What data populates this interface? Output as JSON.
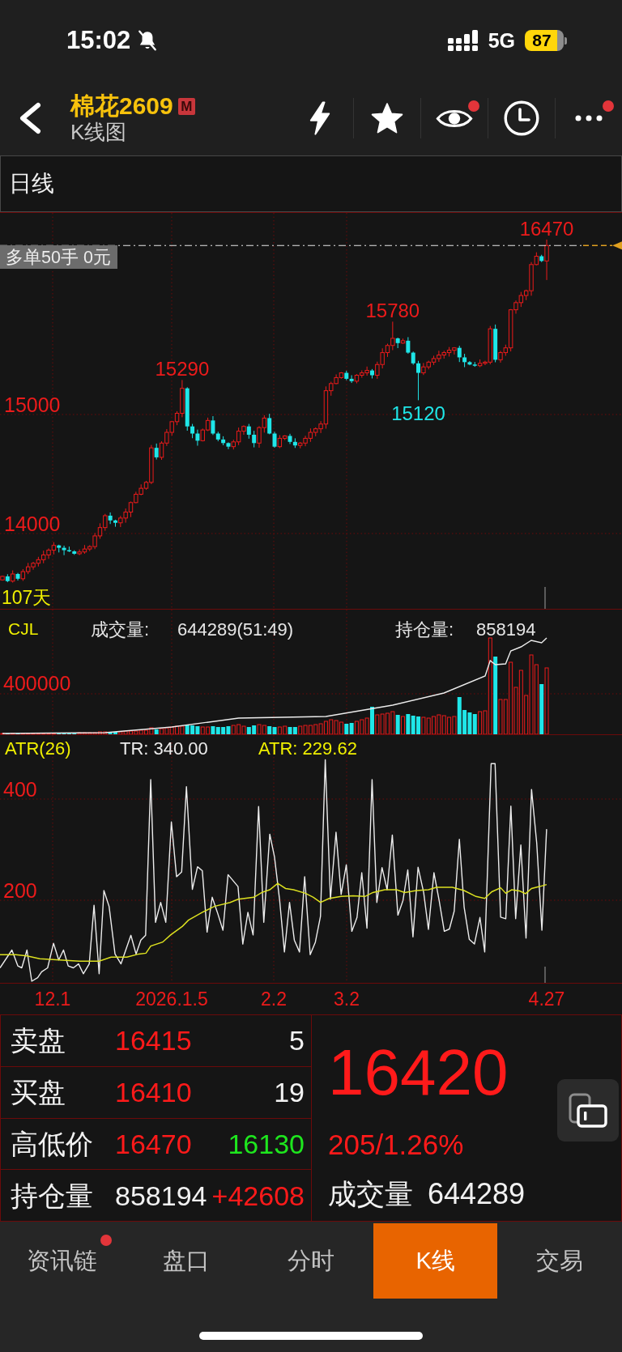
{
  "status_bar": {
    "time": "15:02",
    "network": "5G",
    "battery": "87"
  },
  "header": {
    "title": "棉花2609",
    "badge": "M",
    "subtitle": "K线图",
    "actions": [
      {
        "kind": "flash",
        "unread": false
      },
      {
        "kind": "star",
        "unread": false
      },
      {
        "kind": "eye",
        "unread": true
      },
      {
        "kind": "clock",
        "unread": false
      },
      {
        "kind": "more",
        "unread": true
      }
    ]
  },
  "period": {
    "label": "日线"
  },
  "price_chart": {
    "peak_labels": [
      {
        "text": "16470",
        "kind": "high"
      },
      {
        "text": "15780",
        "kind": "high"
      },
      {
        "text": "15290",
        "kind": "high"
      },
      {
        "text": "15120",
        "kind": "low"
      }
    ],
    "position_label": "多单50手 0元",
    "ticks": [
      "15000",
      "14000"
    ],
    "day_count": "107天"
  },
  "volume_chart": {
    "indicator": "CJL",
    "volume_label": "成交量:",
    "volume_value": "644289(51:49)",
    "open_interest_label": "持仓量:",
    "open_interest_value": "858194",
    "ticks": [
      "400000"
    ]
  },
  "atr_chart": {
    "indicator": "ATR(26)",
    "tr": "TR: 340.00",
    "atr": "ATR: 229.62",
    "ticks": [
      "400",
      "200"
    ]
  },
  "date_axis": [
    "12.1",
    "2026.1.5",
    "2.2",
    "3.2",
    "4.27"
  ],
  "quote": {
    "rows": [
      {
        "label": "卖盘",
        "cells": [
          {
            "text": "16415",
            "color": "#ff1a1a"
          },
          {
            "text": "5",
            "color": "#f2f2f2"
          }
        ]
      },
      {
        "label": "买盘",
        "cells": [
          {
            "text": "16410",
            "color": "#ff1a1a"
          },
          {
            "text": "19",
            "color": "#f2f2f2"
          }
        ]
      },
      {
        "label": "高低价",
        "cells": [
          {
            "text": "16470",
            "color": "#ff1a1a"
          },
          {
            "text": "16130",
            "color": "#1ee61e"
          }
        ]
      },
      {
        "label": "持仓量",
        "cells": [
          {
            "text": "858194",
            "color": "#f2f2f2"
          },
          {
            "text": "+42608",
            "color": "#ff1a1a"
          }
        ]
      }
    ],
    "last_price": "16420",
    "change": "205/1.26%",
    "volume_label": "成交量",
    "volume_value": "644289"
  },
  "tabs": [
    {
      "label": "资讯链",
      "selected": false,
      "unread": true
    },
    {
      "label": "盘口",
      "selected": false,
      "unread": false
    },
    {
      "label": "分时",
      "selected": false,
      "unread": false
    },
    {
      "label": "K线",
      "selected": true,
      "unread": false
    },
    {
      "label": "交易",
      "selected": false,
      "unread": false
    }
  ]
}
